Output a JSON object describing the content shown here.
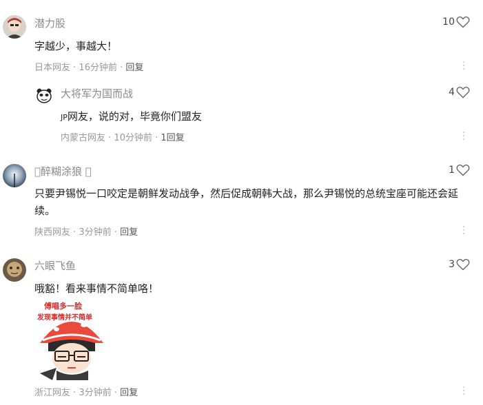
{
  "comments": [
    {
      "username": "潜力股",
      "content": "字越少，事越大！",
      "location": "日本网友",
      "time": "16分钟前",
      "reply_label": "回复",
      "likes": "10",
      "replies": [
        {
          "username": "大将军为国而战",
          "content_prefix": "JP",
          "content": "网友，说的对，毕竟你们盟友",
          "location": "内蒙古网友",
          "time": "10分钟前",
          "reply_label": "1回复",
          "likes": "4"
        }
      ]
    },
    {
      "username": "\u0000醉糊涂狼 \u0000",
      "content": "只要尹锡悦一口咬定是朝鲜发动战争，然后促成朝韩大战，那么尹锡悦的总统宝座可能还会延续。",
      "location": "陕西网友",
      "time": "3分钟前",
      "reply_label": "回复",
      "likes": "1"
    },
    {
      "username": "六眼飞鱼",
      "content": "哦豁！看来事情不简单咯！",
      "location": "浙江网友",
      "time": "3分钟前",
      "reply_label": "回复",
      "likes": "3",
      "sticker_caption_line1": "傅唱多一脸",
      "sticker_caption_line2": "发现事情并不简单"
    }
  ],
  "separator": " · ",
  "icons": {
    "like": "heart-outline-icon",
    "more": "vertical-dots-icon"
  },
  "colors": {
    "username": "#8a8a8a",
    "text": "#222222",
    "meta": "#999999",
    "reply": "#555555"
  }
}
